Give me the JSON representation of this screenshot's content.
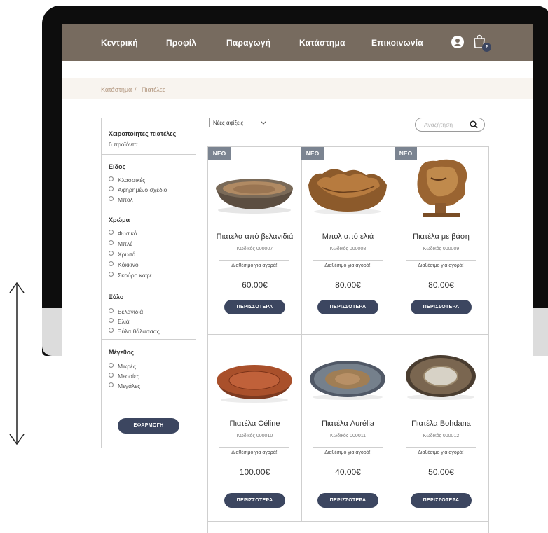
{
  "nav": {
    "items": [
      "Κεντρική",
      "Προφίλ",
      "Παραγωγή",
      "Κατάστημα",
      "Επικοινωνία"
    ],
    "active_index": 3,
    "cart_count": "2"
  },
  "breadcrumb": {
    "parent": "Κατάστημα",
    "separator": "/",
    "current": "Πιατέλες"
  },
  "filters": {
    "header_title": "Χειροποίητες πιατέλες",
    "header_count": "6 προϊόντα",
    "sections": [
      {
        "title": "Είδος",
        "options": [
          "Κλασσικές",
          "Αφηρημένο σχέδιο",
          "Μπολ"
        ]
      },
      {
        "title": "Χρώμα",
        "options": [
          "Φυσικό",
          "Μπλέ",
          "Χρυσό",
          "Κόκκινο",
          "Σκούρο καφέ"
        ]
      },
      {
        "title": "Ξύλο",
        "options": [
          "Βελανιδιά",
          "Ελιά",
          "Ξύλα θάλασσας"
        ]
      },
      {
        "title": "Μέγεθος",
        "options": [
          "Μικρές",
          "Μεσαίες",
          "Μεγάλες"
        ]
      }
    ],
    "apply_label": "ΕΦΑΡΜΟΓΗ"
  },
  "toolbar": {
    "sort_value": "Νέες αφίξεις",
    "search_placeholder": "Αναζήτηση"
  },
  "products": [
    {
      "badge": "ΝΕΟ",
      "name": "Πιατέλα από βελανιδιά",
      "code": "Κωδικός 000007",
      "availability": "Διαθέσιμο για αγορά!",
      "price": "60.00€",
      "button": "ΠΕΡΙΣΣΟΤΕΡΑ"
    },
    {
      "badge": "ΝΕΟ",
      "name": "Μπολ από ελιά",
      "code": "Κωδικός 000008",
      "availability": "Διαθέσιμο για αγορά!",
      "price": "80.00€",
      "button": "ΠΕΡΙΣΣΟΤΕΡΑ"
    },
    {
      "badge": "ΝΕΟ",
      "name": "Πιατέλα με βάση",
      "code": "Κωδικός 000009",
      "availability": "Διαθέσιμο για αγορά!",
      "price": "80.00€",
      "button": "ΠΕΡΙΣΣΟΤΕΡΑ"
    },
    {
      "badge": "",
      "name": "Πιατέλα Céline",
      "code": "Κωδικός 000010",
      "availability": "Διαθέσιμο για αγορά!",
      "price": "100.00€",
      "button": "ΠΕΡΙΣΣΟΤΕΡΑ"
    },
    {
      "badge": "",
      "name": "Πιατέλα Aurélia",
      "code": "Κωδικός 000011",
      "availability": "Διαθέσιμο για αγορά!",
      "price": "40.00€",
      "button": "ΠΕΡΙΣΣΟΤΕΡΑ"
    },
    {
      "badge": "",
      "name": "Πιατέλα Bohdana",
      "code": "Κωδικός 000012",
      "availability": "Διαθέσιμο για αγορά!",
      "price": "50.00€",
      "button": "ΠΕΡΙΣΣΟΤΕΡΑ"
    }
  ],
  "colors": {
    "nav_bg": "#776b5f",
    "button_bg": "#3c4660",
    "breadcrumb_bg": "#f8f4ef",
    "badge_bg": "#7b8491"
  }
}
